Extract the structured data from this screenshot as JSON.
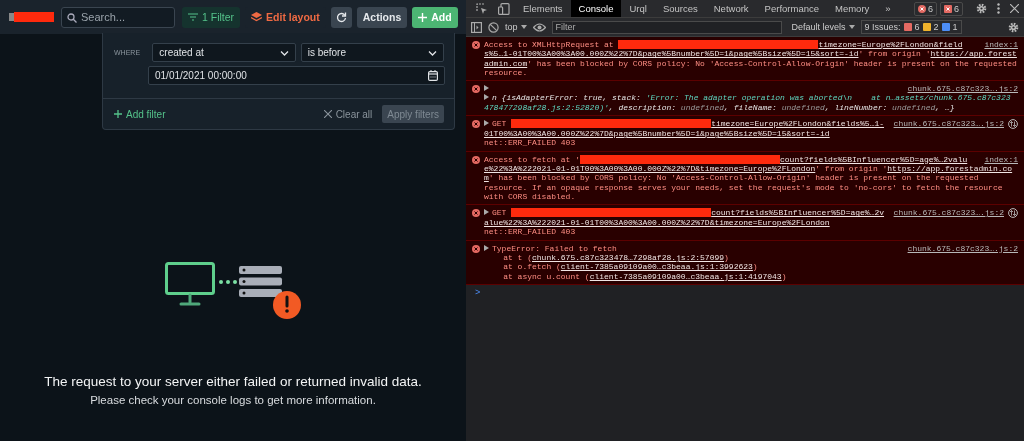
{
  "app": {
    "toolbar": {
      "search": {
        "placeholder": "Search..."
      },
      "filter_button": "1 Filter",
      "edit_layout_button": "Edit layout",
      "actions_button": "Actions",
      "add_button": "Add"
    },
    "filter_panel": {
      "where_label": "WHERE",
      "field_select": "created at",
      "operator_select": "is before",
      "date_value": "01/01/2021 00:00:00",
      "add_filter": "Add filter",
      "clear_all": "Clear all",
      "apply_button": {
        "label": "Apply filters",
        "disabled": true
      }
    },
    "error_message": {
      "title": "The request to your server either failed or returned invalid data.",
      "hint": "Please check your console logs to get more information."
    }
  },
  "devtools": {
    "tabs": [
      {
        "label": "Elements",
        "selected": false
      },
      {
        "label": "Console",
        "selected": true
      },
      {
        "label": "Urql",
        "selected": false
      },
      {
        "label": "Sources",
        "selected": false
      },
      {
        "label": "Network",
        "selected": false
      },
      {
        "label": "Performance",
        "selected": false
      },
      {
        "label": "Memory",
        "selected": false
      }
    ],
    "more_tabs": "»",
    "error_count": "6",
    "issue_count": "6",
    "context_select": "top",
    "filter": {
      "placeholder": "Filter"
    },
    "levels_select": "Default levels",
    "issues": {
      "label": "9 Issues:",
      "errors": "6",
      "warnings": "2",
      "info": "1"
    },
    "messages": [
      {
        "kind": "error",
        "expandable": false,
        "source": "index:1",
        "network": false,
        "lines": [
          [
            {
              "kind": "text",
              "text": "Access to XMLHttpRequest at "
            },
            {
              "kind": "redacted"
            },
            {
              "kind": "link",
              "text": "timezone=Europe%2FLondon&field"
            }
          ],
          [
            {
              "kind": "link",
              "text": "s%5…1-01T00%3A00%3A00.000Z%22%7D&page%5Bnumber%5D=1&page%5Bsize%5D=15&sort=-id"
            },
            {
              "kind": "text",
              "text": "' from origin '"
            },
            {
              "kind": "link",
              "text": "https://app.forest"
            }
          ],
          [
            {
              "kind": "link",
              "text": "admin.com"
            },
            {
              "kind": "text",
              "text": "' has been blocked by CORS policy: No 'Access-Control-Allow-Origin' header is present on the requested"
            }
          ],
          [
            {
              "kind": "text",
              "text": "resource."
            }
          ]
        ]
      },
      {
        "kind": "object",
        "expandable": true,
        "source": "chunk.675.c87c323….js:2",
        "network": false,
        "lines": [
          [
            {
              "kind": "obj",
              "text": "n {isAdapterError: true, stack: "
            },
            {
              "kind": "str",
              "text": "'Error: The adapter operation was aborted\\n    at n…assets/chunk.675.c87c323"
            }
          ],
          [
            {
              "kind": "str",
              "text": "478477298af28.js:2:52820)'"
            },
            {
              "kind": "obj",
              "text": ", description: "
            },
            {
              "kind": "undef",
              "text": "undefined"
            },
            {
              "kind": "obj",
              "text": ", fileName: "
            },
            {
              "kind": "undef",
              "text": "undefined"
            },
            {
              "kind": "obj",
              "text": ", lineNumber: "
            },
            {
              "kind": "undef",
              "text": "undefined"
            },
            {
              "kind": "obj",
              "text": ", …}"
            }
          ]
        ]
      },
      {
        "kind": "error",
        "expandable": true,
        "source": "chunk.675.c87c323….js:2",
        "network": true,
        "lines": [
          [
            {
              "kind": "text",
              "text": "GET "
            },
            {
              "kind": "redacted"
            },
            {
              "kind": "link",
              "text": "timezone=Europe%2FLondon&fields%5…1-"
            }
          ],
          [
            {
              "kind": "link",
              "text": "01T00%3A00%3A00.000Z%22%7D&page%5Bnumber%5D=1&page%5Bsize%5D=15&sort=-id"
            }
          ],
          [
            {
              "kind": "text",
              "text": "net::ERR_FAILED 403"
            }
          ]
        ]
      },
      {
        "kind": "error",
        "expandable": false,
        "source": "index:1",
        "network": false,
        "lines": [
          [
            {
              "kind": "text",
              "text": "Access to fetch at '"
            },
            {
              "kind": "redacted"
            },
            {
              "kind": "link",
              "text": "count?fields%5BInfluencer%5D=age%…2valu"
            }
          ],
          [
            {
              "kind": "link",
              "text": "e%22%3A%222021-01-01T00%3A00%3A00.000Z%22%7D&timezone=Europe%2FLondon"
            },
            {
              "kind": "text",
              "text": "' from origin '"
            },
            {
              "kind": "link",
              "text": "https://app.forestadmin.co"
            }
          ],
          [
            {
              "kind": "link",
              "text": "m"
            },
            {
              "kind": "text",
              "text": "' has been blocked by CORS policy: No 'Access-Control-Allow-Origin' header is present on the requested"
            }
          ],
          [
            {
              "kind": "text",
              "text": "resource. If an opaque response serves your needs, set the request's mode to 'no-cors' to fetch the resource"
            }
          ],
          [
            {
              "kind": "text",
              "text": "with CORS disabled."
            }
          ]
        ]
      },
      {
        "kind": "error",
        "expandable": true,
        "source": "chunk.675.c87c323….js:2",
        "network": true,
        "lines": [
          [
            {
              "kind": "text",
              "text": "GET "
            },
            {
              "kind": "redacted"
            },
            {
              "kind": "link",
              "text": "count?fields%5BInfluencer%5D=age%…2v"
            }
          ],
          [
            {
              "kind": "link",
              "text": "alue%22%3A%222021-01-01T00%3A00%3A00.000Z%22%7D&timezone=Europe%2FLondon"
            }
          ],
          [
            {
              "kind": "text",
              "text": "net::ERR_FAILED 403"
            }
          ]
        ]
      },
      {
        "kind": "error",
        "expandable": true,
        "source": "chunk.675.c87c323….js:2",
        "network": false,
        "lines": [
          [
            {
              "kind": "text",
              "text": "TypeError: Failed to fetch"
            }
          ],
          [
            {
              "kind": "text",
              "text": "    at t ("
            },
            {
              "kind": "link",
              "text": "chunk.675.c87c323478…7298af28.js:2:57099"
            },
            {
              "kind": "text",
              "text": ")"
            }
          ],
          [
            {
              "kind": "text",
              "text": "    at o.fetch ("
            },
            {
              "kind": "link",
              "text": "client-7385a09109a00…c3beaa.js:1:3992623"
            },
            {
              "kind": "text",
              "text": ")"
            }
          ],
          [
            {
              "kind": "text",
              "text": "    at async u.count ("
            },
            {
              "kind": "link",
              "text": "client-7385a09109a00…c3beaa.js:1:4197043"
            },
            {
              "kind": "text",
              "text": ")"
            }
          ]
        ]
      }
    ],
    "prompt": ">"
  }
}
